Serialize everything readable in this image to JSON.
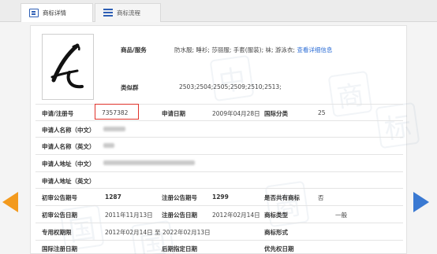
{
  "tabs": [
    {
      "label": "商标详情",
      "icon": "document-icon",
      "active": true
    },
    {
      "label": "商标流程",
      "icon": "list-icon",
      "active": false
    }
  ],
  "goods": {
    "label": "商品/服务",
    "value": "防水服; 睡衫; 莎丽服; 手套(服装); 袜; 游泳衣;",
    "link": "查看详细信息"
  },
  "similar_group": {
    "label": "类似群",
    "value": "2503;2504;2505;2509;2510;2513;"
  },
  "rows": {
    "reg_no_label": "申请/注册号",
    "reg_no": "7357382",
    "apply_date_label": "申请日期",
    "apply_date": "2009年04月28日",
    "class_label": "国际分类",
    "class_value": "25",
    "applicant_cn_label": "申请人名称（中文）",
    "applicant_en_label": "申请人名称（英文）",
    "address_cn_label": "申请人地址（中文）",
    "address_en_label": "申请人地址（英文）",
    "prelim_issue_label": "初审公告期号",
    "prelim_issue": "1287",
    "reg_issue_label": "注册公告期号",
    "reg_issue": "1299",
    "shared_label": "是否共有商标",
    "shared_value": "否",
    "prelim_date_label": "初审公告日期",
    "prelim_date": "2011年11月13日",
    "reg_date_label": "注册公告日期",
    "reg_date": "2012年02月14日",
    "type_label": "商标类型",
    "type_value": "一般",
    "exclusive_label": "专用权期限",
    "exclusive_value": "2012年02月14日 至 2022年02月13日",
    "form_label": "商标形式",
    "intl_reg_date_label": "国际注册日期",
    "later_date_label": "后期指定日期",
    "priority_date_label": "优先权日期"
  },
  "colors": {
    "highlight": "#e0332b",
    "link": "#2f6fd6",
    "prev_arrow": "#f39a1e",
    "next_arrow": "#3a79d2"
  }
}
